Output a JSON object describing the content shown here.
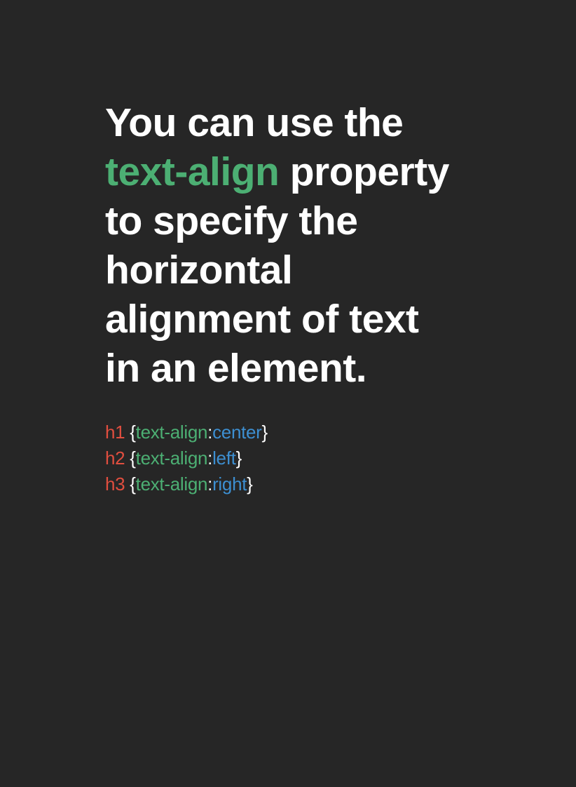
{
  "headline": {
    "line1": "You can use the",
    "line2_accent": "text-align",
    "line2_rest": " property",
    "line3": "to specify the",
    "line4": "horizontal",
    "line5": "alignment of text",
    "line6": "in an element."
  },
  "code": {
    "lines": [
      {
        "selector": "h1",
        "open": " {",
        "property": "text-align",
        "colon": ":",
        "value": "center",
        "close": "}"
      },
      {
        "selector": "h2",
        "open": " {",
        "property": "text-align",
        "colon": ":",
        "value": "left",
        "close": "}"
      },
      {
        "selector": "h3",
        "open": " {",
        "property": "text-align",
        "colon": ":",
        "value": "right",
        "close": "}"
      }
    ]
  },
  "colors": {
    "background": "#262626",
    "text": "#ffffff",
    "accent_green": "#4caf73",
    "selector_red": "#e04e3f",
    "value_blue": "#3d8fd1"
  }
}
